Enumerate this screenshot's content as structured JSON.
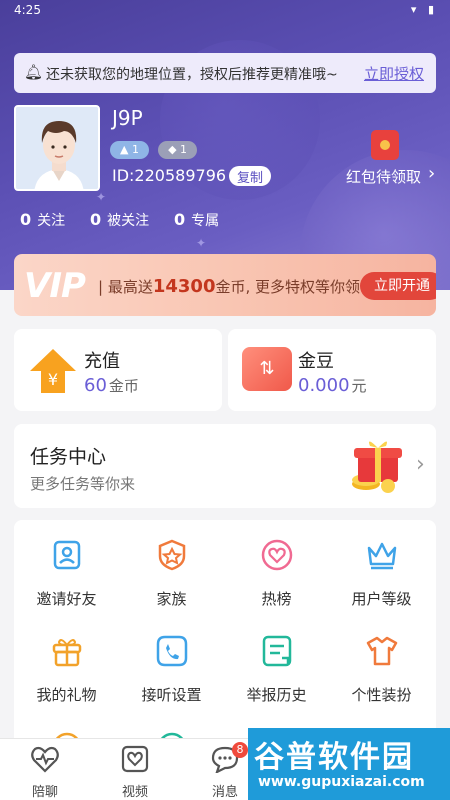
{
  "status": {
    "time": "4:25"
  },
  "location_bar": {
    "message": "还未获取您的地理位置，授权后推荐更精准哦~",
    "action": "立即授权"
  },
  "profile": {
    "username": "J9P",
    "level_badge_1": "1",
    "level_badge_2": "1",
    "id_text": "ID:220589796",
    "copy_label": "复制",
    "red_packet_label": "红包待领取"
  },
  "stats": [
    {
      "count": "0",
      "label": "关注"
    },
    {
      "count": "0",
      "label": "被关注"
    },
    {
      "count": "0",
      "label": "专属"
    }
  ],
  "vip_banner": {
    "logo": "VIP",
    "text_prefix": "最高送",
    "amount": "14300",
    "text_suffix": "金币, 更多特权等你领",
    "button": "立即开通"
  },
  "wallet": {
    "recharge_title": "充值",
    "recharge_value": "60",
    "recharge_unit": "金币",
    "beans_title": "金豆",
    "beans_value": "0.000",
    "beans_unit": "元"
  },
  "task_center": {
    "title": "任务中心",
    "subtitle": "更多任务等你来"
  },
  "features": [
    {
      "label": "邀请好友",
      "icon": "invite-icon"
    },
    {
      "label": "家族",
      "icon": "family-icon"
    },
    {
      "label": "热榜",
      "icon": "heart-icon"
    },
    {
      "label": "用户等级",
      "icon": "crown-icon"
    },
    {
      "label": "我的礼物",
      "icon": "gift-box-icon"
    },
    {
      "label": "接听设置",
      "icon": "phone-icon"
    },
    {
      "label": "举报历史",
      "icon": "report-icon"
    },
    {
      "label": "个性装扮",
      "icon": "shirt-icon"
    }
  ],
  "bottom_nav": [
    {
      "label": "陪聊",
      "icon": "pulse-heart-icon"
    },
    {
      "label": "视频",
      "icon": "video-heart-icon"
    },
    {
      "label": "消息",
      "icon": "message-icon",
      "badge": "8"
    }
  ],
  "watermark": {
    "main": "谷普软件园",
    "url": "www.gupuxiazai.com"
  },
  "colors": {
    "accent": "#6a5ed6",
    "hero": "#5b4fb3",
    "vip_button": "#e2463b"
  }
}
